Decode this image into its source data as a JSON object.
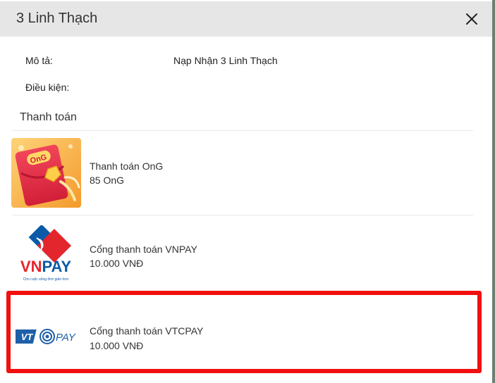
{
  "dialog": {
    "title": "3 Linh Thạch",
    "close_icon": "close-icon"
  },
  "info": {
    "description_label": "Mô tả:",
    "description_value": "Nạp Nhận 3 Linh Thạch",
    "conditions_label": "Điều kiện:",
    "conditions_value": ""
  },
  "payment": {
    "section_title": "Thanh toán",
    "methods": [
      {
        "name": "Thanh toán OnG",
        "price": "85 OnG",
        "logo": "ong-logo",
        "logo_text": "OnG",
        "selected": false
      },
      {
        "name": "Cổng thanh toán VNPAY",
        "price": "10.000 VNĐ",
        "logo": "vnpay-logo",
        "logo_text": "VNPAY",
        "logo_tagline": "Cho cuộc sống đơn giản hơn",
        "selected": false
      },
      {
        "name": "Cổng thanh toán VTCPAY",
        "price": "10.000 VNĐ",
        "logo": "vtcpay-logo",
        "logo_text": "VTC PAY",
        "selected": true
      }
    ]
  },
  "colors": {
    "header_bg": "#e6e6e6",
    "highlight": "#f20f0f",
    "vnpay_red": "#e3262d",
    "vnpay_blue": "#0b5aa8",
    "vtc_blue": "#1e5fa8"
  }
}
